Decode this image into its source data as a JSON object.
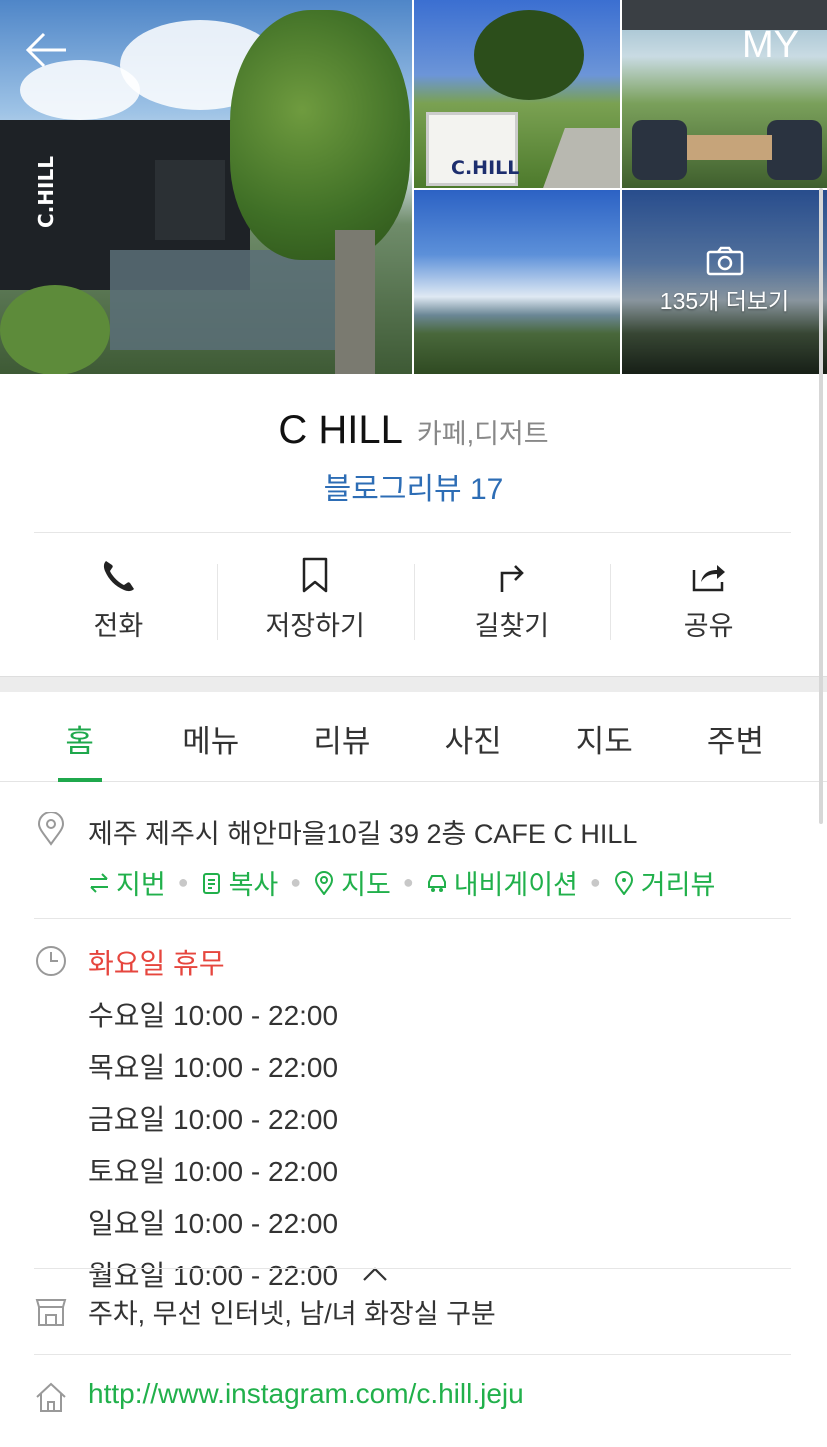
{
  "header": {
    "my_label": "MY",
    "more_photos_label": "135개 더보기",
    "photo_text_main": "C.HILL",
    "photo_text_sign": "C.HILL"
  },
  "place": {
    "name": "C HILL",
    "category": "카페,디저트",
    "blog_review": "블로그리뷰 17"
  },
  "actions": [
    {
      "label": "전화",
      "icon": "phone-icon"
    },
    {
      "label": "저장하기",
      "icon": "bookmark-icon"
    },
    {
      "label": "길찾기",
      "icon": "directions-icon"
    },
    {
      "label": "공유",
      "icon": "share-icon"
    }
  ],
  "tabs": [
    {
      "label": "홈",
      "active": true
    },
    {
      "label": "메뉴",
      "active": false
    },
    {
      "label": "리뷰",
      "active": false
    },
    {
      "label": "사진",
      "active": false
    },
    {
      "label": "지도",
      "active": false
    },
    {
      "label": "주변",
      "active": false
    }
  ],
  "address": {
    "text": "제주 제주시 해안마을10길 39 2층 CAFE C HILL",
    "links": [
      "지번",
      "복사",
      "지도",
      "내비게이션",
      "거리뷰"
    ]
  },
  "hours": {
    "closed": "화요일 휴무",
    "lines": [
      "수요일 10:00 - 22:00",
      "목요일 10:00 - 22:00",
      "금요일 10:00 - 22:00",
      "토요일 10:00 - 22:00",
      "일요일 10:00 - 22:00",
      "월요일 10:00 - 22:00"
    ]
  },
  "amenities": "주차, 무선 인터넷, 남/녀 화장실 구분",
  "homepage": "http://www.instagram.com/c.hill.jeju",
  "colors": {
    "accent_green": "#1fa84c",
    "link_blue": "#2d6db5",
    "closed_red": "#e6463e"
  }
}
